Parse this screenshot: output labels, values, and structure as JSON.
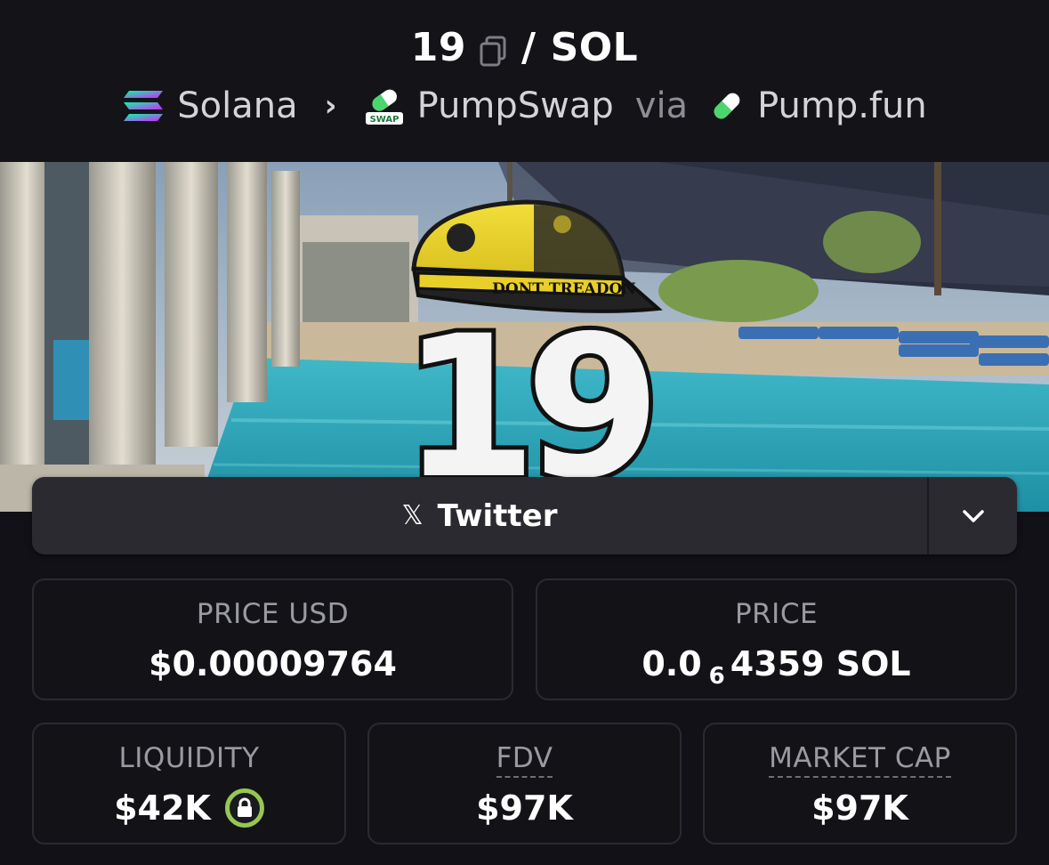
{
  "header": {
    "token_symbol": "19",
    "separator": "/",
    "quote_symbol": "SOL",
    "chain": "Solana",
    "dex": "PumpSwap",
    "dex_badge": "SWAP",
    "via": "via",
    "launchpad": "Pump.fun"
  },
  "banner": {
    "hat_text": "DONT TREADON",
    "big_number": "19"
  },
  "social": {
    "twitter_label": "Twitter",
    "twitter_icon": "x-icon",
    "more_icon": "chevron-down-icon"
  },
  "stats": {
    "price_usd": {
      "label": "PRICE USD",
      "value": "$0.00009764"
    },
    "price_native": {
      "label": "PRICE",
      "value_prefix": "0.0",
      "value_zeros": "6",
      "value_suffix": "4359 SOL"
    },
    "liquidity": {
      "label": "LIQUIDITY",
      "value": "$42K",
      "icon": "lock-icon"
    },
    "fdv": {
      "label": "FDV",
      "value": "$97K"
    },
    "market_cap": {
      "label": "MARKET CAP",
      "value": "$97K"
    }
  },
  "colors": {
    "background": "#111117",
    "card_border": "#2a2a30",
    "lock_ring": "#98c652",
    "muted_text": "#9a9aa2"
  }
}
